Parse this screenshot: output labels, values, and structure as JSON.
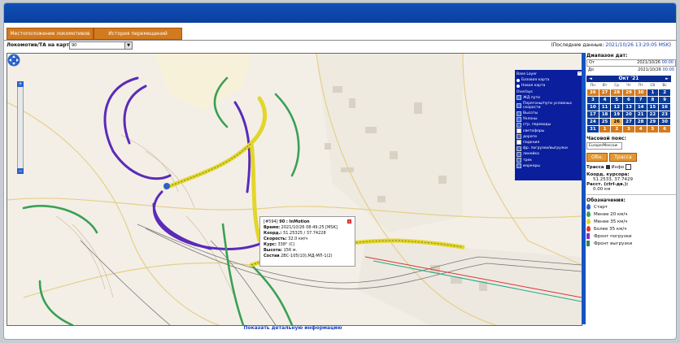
{
  "tabs": {
    "location": "Местоположение локомотивов",
    "history": "История перемещений"
  },
  "toolbar": {
    "label": "Локомотив/ТА на карте:",
    "selected": "90",
    "last_label": "(Последние данные: ",
    "last_value": "2021/10/26 13:20:05 MSK",
    "last_end": ")"
  },
  "layers": {
    "title": "Base Layer",
    "base": [
      "Базовая карта",
      "Новая карта"
    ],
    "overlays_title": "Overlays",
    "overlays": [
      "ЖД пути",
      "Перегоны/пути условных скорости",
      "Высоты",
      "Уклоны",
      "стр. переводы",
      "светофоры",
      "дороги",
      "падения",
      "фр. погрузки/выгрузки",
      "линейка",
      "трек",
      "маркеры"
    ]
  },
  "popup": {
    "id": "[#594]",
    "name": "90 : InMotion",
    "time_label": "Время:",
    "time": "2021/10/26 08:49:25 [MSK]",
    "coord_label": "Коорд.:",
    "coord": "51.25325 / 37.74228",
    "speed_label": "Скорость:",
    "speed": "32.0 км/ч",
    "course_label": "Курс:",
    "course": "338° (С)",
    "alt_label": "Высота:",
    "alt": "156 м.",
    "comp_label": "Состав",
    "comp": "2ВС-105(10),МД-МП-1(2)"
  },
  "detail_link": "Показать детальную информацию",
  "side": {
    "range_title": "Диапазон дат:",
    "from_label": "От",
    "from": "2021/10/26",
    "from_time": "00:00",
    "to_label": "До",
    "to": "2021/10/26",
    "to_time": "00:00",
    "cal_month": "Окт '21",
    "weekdays": [
      "Пн",
      "Вт",
      "Ср",
      "Чт",
      "Пт",
      "Сб",
      "Вс"
    ],
    "tz_title": "Часовой пояс:",
    "tz": "Europe/Moscow",
    "btn_refresh": "Обн.",
    "btn_track": "Трасса",
    "track_label": "Трасса",
    "info_label": "Инфо",
    "cursor_label": "Коорд. курсора:",
    "cursor": "51.2533, 37.7429",
    "dist_label": "Расст. (ctrl-дв.):",
    "dist": "0.00 км",
    "legend_title": "Обозначения:",
    "legend": [
      "Старт",
      "Менее 20 км/ч",
      "Менее 35 км/ч",
      "Более 35 км/ч",
      "Фронт погрузки",
      "Фронт выгрузки"
    ]
  },
  "calendar": [
    [
      "26",
      "27",
      "28",
      "29",
      "30",
      "1",
      "2"
    ],
    [
      "3",
      "4",
      "5",
      "6",
      "7",
      "8",
      "9"
    ],
    [
      "10",
      "11",
      "12",
      "13",
      "14",
      "15",
      "16"
    ],
    [
      "17",
      "18",
      "19",
      "20",
      "21",
      "22",
      "23"
    ],
    [
      "24",
      "25",
      "26",
      "27",
      "28",
      "29",
      "30"
    ],
    [
      "31",
      "1",
      "2",
      "3",
      "4",
      "5",
      "6"
    ]
  ],
  "colors": {
    "accent": "#0b3c9a",
    "orange": "#d27a1e",
    "track_green": "#3aa055",
    "track_purple": "#5b2bb8"
  }
}
